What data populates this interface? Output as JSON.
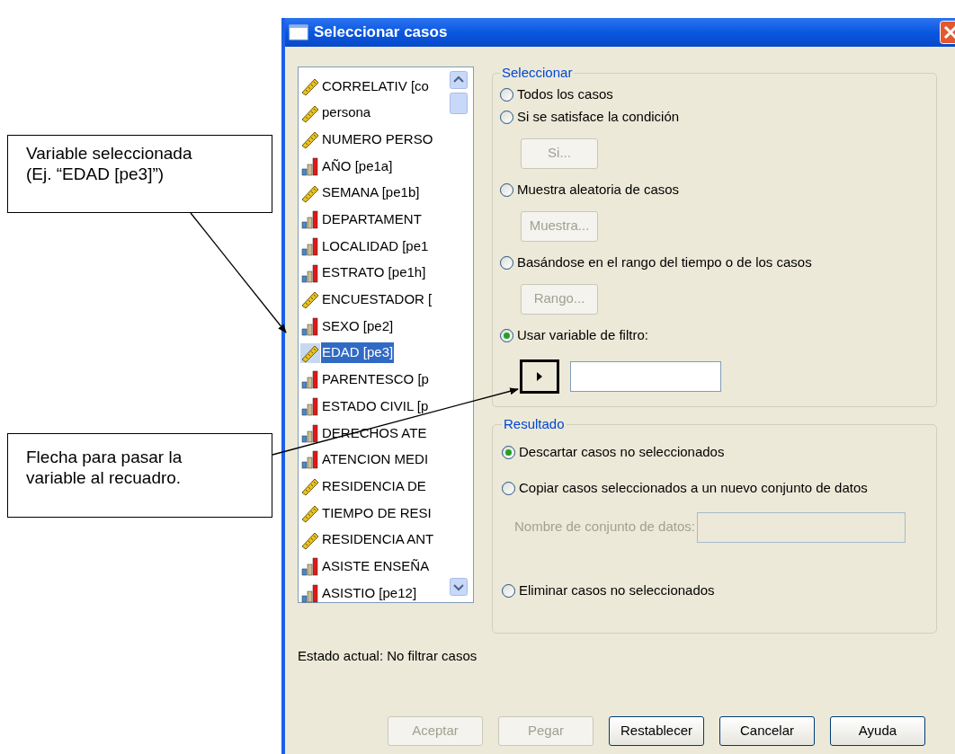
{
  "window": {
    "title": "Seleccionar casos"
  },
  "callouts": [
    "Variable seleccionada\n(Ej. “EDAD [pe3]”)",
    "Flecha para pasar la\nvariable al recuadro."
  ],
  "variables": [
    {
      "label": "CORRELATIV [co",
      "kind": "scale",
      "selected": false
    },
    {
      "label": "persona",
      "kind": "scale",
      "selected": false
    },
    {
      "label": "NUMERO PERSO",
      "kind": "scale",
      "selected": false
    },
    {
      "label": "AÑO [pe1a]",
      "kind": "ordinal",
      "selected": false
    },
    {
      "label": "SEMANA [pe1b]",
      "kind": "scale",
      "selected": false
    },
    {
      "label": "DEPARTAMENT",
      "kind": "ordinal",
      "selected": false
    },
    {
      "label": "LOCALIDAD [pe1",
      "kind": "ordinal",
      "selected": false
    },
    {
      "label": "ESTRATO [pe1h]",
      "kind": "ordinal",
      "selected": false
    },
    {
      "label": "ENCUESTADOR [",
      "kind": "scale",
      "selected": false
    },
    {
      "label": "SEXO [pe2]",
      "kind": "ordinal",
      "selected": false
    },
    {
      "label": "EDAD [pe3]",
      "kind": "scale",
      "selected": true
    },
    {
      "label": "PARENTESCO [p",
      "kind": "ordinal",
      "selected": false
    },
    {
      "label": "ESTADO CIVIL [p",
      "kind": "ordinal",
      "selected": false
    },
    {
      "label": "DERECHOS ATE",
      "kind": "ordinal",
      "selected": false
    },
    {
      "label": "ATENCION MEDI",
      "kind": "ordinal",
      "selected": false
    },
    {
      "label": "RESIDENCIA DE",
      "kind": "scale",
      "selected": false
    },
    {
      "label": "TIEMPO DE RESI",
      "kind": "scale",
      "selected": false
    },
    {
      "label": "RESIDENCIA ANT",
      "kind": "scale",
      "selected": false
    },
    {
      "label": "ASISTE ENSEÑA",
      "kind": "ordinal",
      "selected": false
    },
    {
      "label": "ASISTIO [pe12]",
      "kind": "ordinal",
      "selected": false
    }
  ],
  "seleccionar": {
    "title": "Seleccionar",
    "options": [
      {
        "label": "Todos los casos",
        "selected": false
      },
      {
        "label": "Si se satisface la condición",
        "selected": false,
        "button": {
          "label": "Si...",
          "disabled": true
        }
      },
      {
        "label": "Muestra aleatoria de casos",
        "selected": false,
        "button": {
          "label": "Muestra...",
          "disabled": true
        }
      },
      {
        "label": "Basándose en el rango del tiempo o de los casos",
        "selected": false,
        "button": {
          "label": "Rango...",
          "disabled": true
        }
      },
      {
        "label": "Usar variable de filtro:",
        "selected": true
      }
    ]
  },
  "resultado": {
    "title": "Resultado",
    "options": [
      {
        "label": "Descartar casos no seleccionados",
        "selected": true
      },
      {
        "label": "Copiar casos seleccionados a un nuevo conjunto de datos",
        "selected": false
      },
      {
        "label": "Eliminar casos no seleccionados",
        "selected": false
      }
    ],
    "dataset_label": "Nombre de conjunto de datos:",
    "dataset_disabled": true
  },
  "status": "Estado actual: No filtrar casos",
  "buttons": [
    {
      "label": "Aceptar",
      "disabled": true
    },
    {
      "label": "Pegar",
      "disabled": true
    },
    {
      "label": "Restablecer",
      "disabled": false
    },
    {
      "label": "Cancelar",
      "disabled": false
    },
    {
      "label": "Ayuda",
      "disabled": false
    }
  ]
}
